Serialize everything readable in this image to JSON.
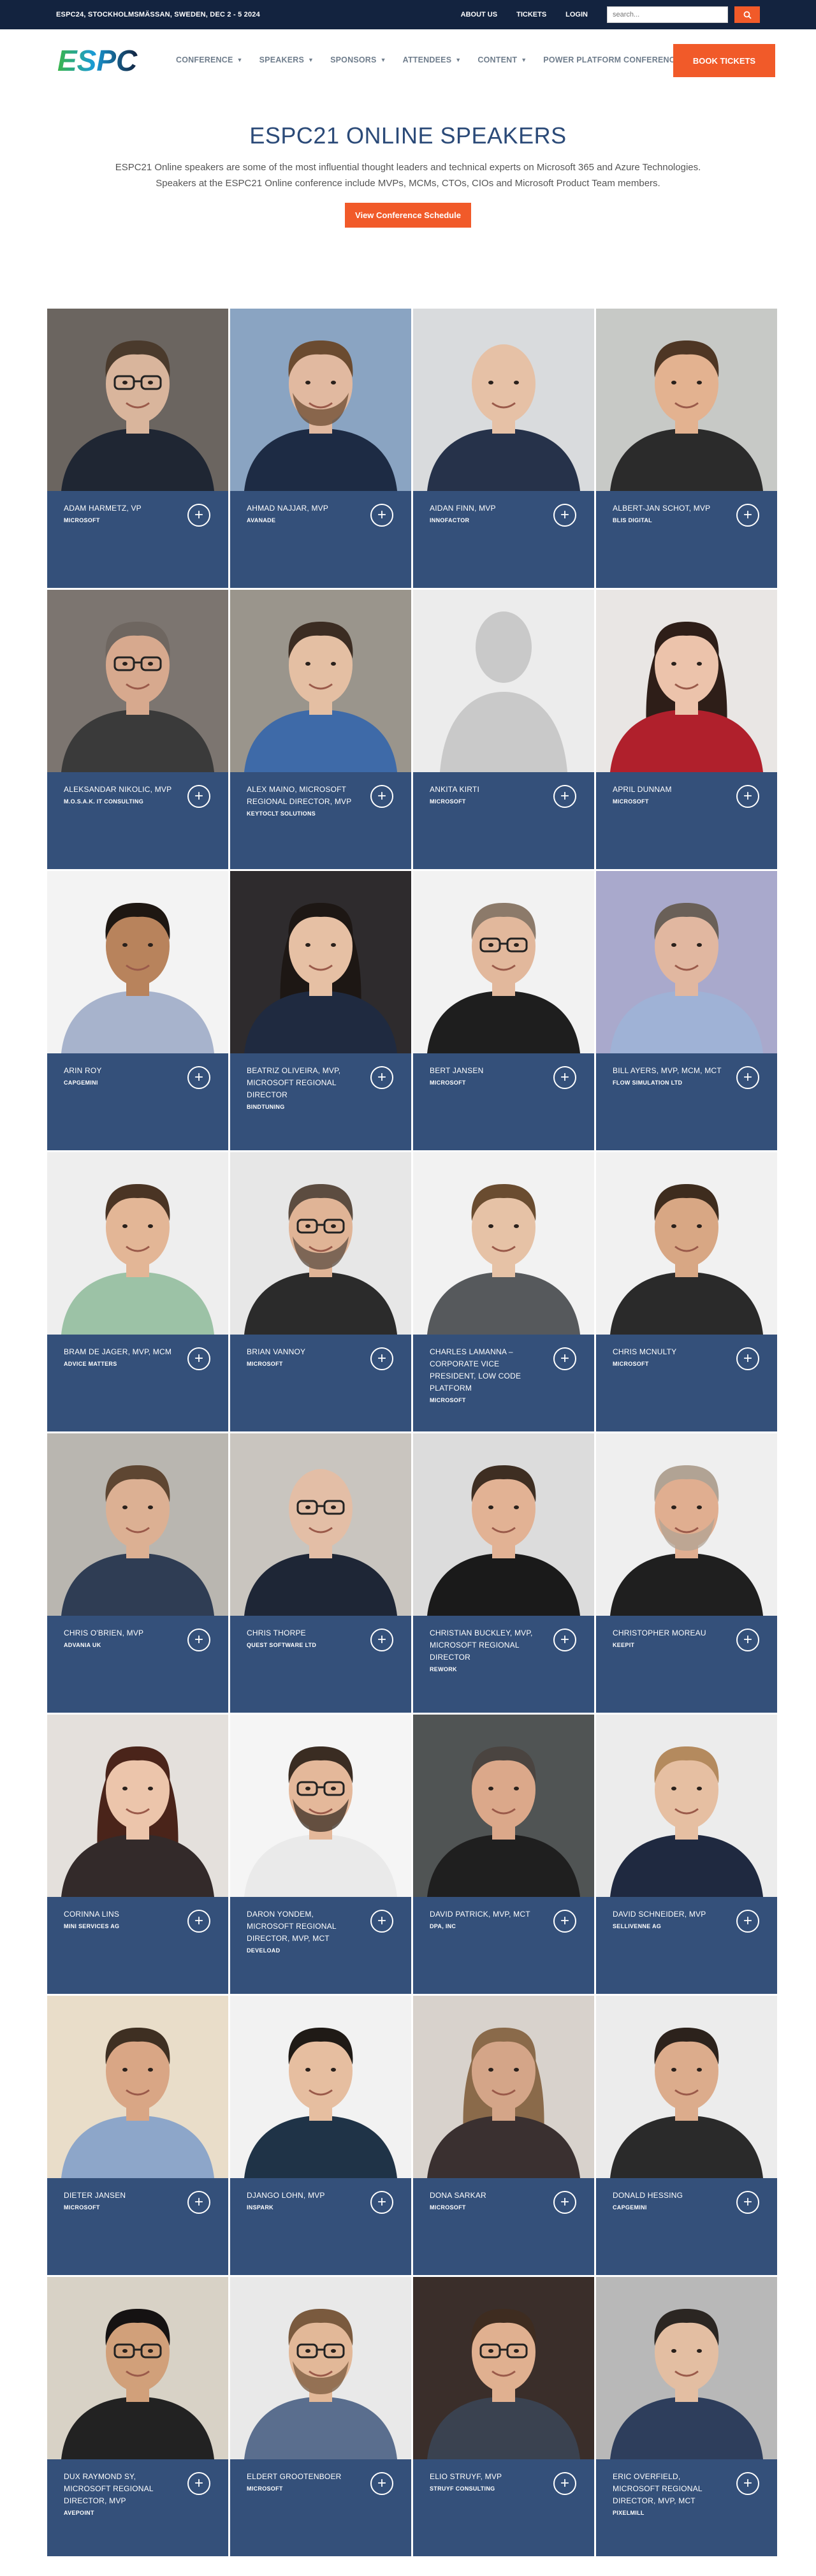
{
  "topbar": {
    "event": "ESPC24, STOCKHOLMSMÄSSAN, SWEDEN, DEC 2 - 5 2024",
    "links": [
      "ABOUT US",
      "TICKETS",
      "LOGIN"
    ],
    "search_placeholder": "search..."
  },
  "nav": {
    "logo_text": "ESPC",
    "items": [
      "CONFERENCE",
      "SPEAKERS",
      "SPONSORS",
      "ATTENDEES",
      "CONTENT",
      "POWER PLATFORM CONFERENCE"
    ],
    "book_label": "BOOK TICKETS"
  },
  "hero": {
    "title": "ESPC21 ONLINE SPEAKERS",
    "description": "ESPC21 Online speakers are some of the most influential thought leaders and technical experts on Microsoft 365 and Azure Technologies. Speakers at the ESPC21 Online conference include MVPs, MCMs, CTOs, CIOs and Microsoft Product Team members.",
    "cta_label": "View Conference Schedule"
  },
  "colors": {
    "topbar": "#13233f",
    "accent": "#f15a29",
    "card": "#34507a",
    "title": "#2b4a78"
  },
  "speakers": [
    {
      "name": "ADAM HARMETZ, VP",
      "company": "MICROSOFT",
      "bg": "#6b6560",
      "skin": "#d9b59c",
      "hair": "#4a3a2c",
      "shirt": "#1f2633",
      "glasses": true
    },
    {
      "name": "AHMAD NAJJAR, MVP",
      "company": "AVANADE",
      "bg": "#8aa4c2",
      "skin": "#e1b9a0",
      "hair": "#6b4b30",
      "shirt": "#1d2b44",
      "beard": true
    },
    {
      "name": "AIDAN FINN, MVP",
      "company": "INNOFACTOR",
      "bg": "#d9dbdd",
      "skin": "#e6c1a6",
      "hair": "#d8b79e",
      "shirt": "#26324a",
      "bald": true
    },
    {
      "name": "ALBERT-JAN SCHOT, MVP",
      "company": "BLIS DIGITAL",
      "bg": "#c7c9c6",
      "skin": "#e3b290",
      "hair": "#4e3624",
      "shirt": "#2b2b2b"
    },
    {
      "name": "ALEKSANDAR NIKOLIC, MVP",
      "company": "M.O.S.A.K. IT CONSULTING",
      "bg": "#7c7570",
      "skin": "#d7a98e",
      "hair": "#6e6660",
      "shirt": "#3a3a3a",
      "glasses": true
    },
    {
      "name": "ALEX MAINO, MICROSOFT REGIONAL DIRECTOR, MVP",
      "company": "KEYTOCLT SOLUTIONS",
      "bg": "#9a958c",
      "skin": "#e4bfa3",
      "hair": "#3b2c22",
      "shirt": "#3e6aa8"
    },
    {
      "name": "ANKITA KIRTI",
      "company": "MICROSOFT",
      "bg": "#ececec",
      "skin": "#c8c8c8",
      "hair": "#c8c8c8",
      "shirt": "#c8c8c8",
      "placeholder": true
    },
    {
      "name": "APRIL DUNNAM",
      "company": "MICROSOFT",
      "bg": "#e9e6e4",
      "skin": "#ecc3ab",
      "hair": "#2e1e18",
      "shirt": "#b0202c",
      "longhair": true
    },
    {
      "name": "ARIN ROY",
      "company": "CAPGEMINI",
      "bg": "#f3f3f3",
      "skin": "#b8835c",
      "hair": "#1e1712",
      "shirt": "#a7b3cc"
    },
    {
      "name": "BEATRIZ OLIVEIRA, MVP, MICROSOFT REGIONAL DIRECTOR",
      "company": "BINDTUNING",
      "bg": "#2e2b2d",
      "skin": "#e6c0a4",
      "hair": "#1d1714",
      "shirt": "#1f2a40",
      "longhair": true
    },
    {
      "name": "BERT JANSEN",
      "company": "MICROSOFT",
      "bg": "#f2f2f2",
      "skin": "#e2b89c",
      "hair": "#8c7a6a",
      "shirt": "#1e1e1e",
      "glasses": true
    },
    {
      "name": "BILL AYERS, MVP, MCM, MCT",
      "company": "FLOW SIMULATION LTD",
      "bg": "#a9a9cc",
      "skin": "#e1b7a0",
      "hair": "#6a6058",
      "shirt": "#9fb2d6"
    },
    {
      "name": "BRAM DE JAGER, MVP, MCM",
      "company": "ADVICE MATTERS",
      "bg": "#eeeeee",
      "skin": "#e3b696",
      "hair": "#4a3424",
      "shirt": "#9cc2a6"
    },
    {
      "name": "BRIAN VANNOY",
      "company": "MICROSOFT",
      "bg": "#e7e7e7",
      "skin": "#e0b496",
      "hair": "#5c4c40",
      "shirt": "#2b2b2b",
      "glasses": true,
      "beard": true
    },
    {
      "name": "CHARLES LAMANNA – CORPORATE VICE PRESIDENT, LOW CODE PLATFORM",
      "company": "MICROSOFT",
      "bg": "#f2f2f2",
      "skin": "#e6c2a6",
      "hair": "#6a4c30",
      "shirt": "#56595c"
    },
    {
      "name": "CHRIS MCNULTY",
      "company": "MICROSOFT",
      "bg": "#f1f1f1",
      "skin": "#d8a784",
      "hair": "#3e2c1e",
      "shirt": "#2a2a2a"
    },
    {
      "name": "CHRIS O'BRIEN, MVP",
      "company": "ADVANIA UK",
      "bg": "#b9b6b0",
      "skin": "#dcb093",
      "hair": "#5e4632",
      "shirt": "#2f3d54"
    },
    {
      "name": "CHRIS THORPE",
      "company": "QUEST SOFTWARE LTD",
      "bg": "#c9c5bf",
      "skin": "#e3bea6",
      "hair": "#9a8a7c",
      "shirt": "#1e2636",
      "bald": true,
      "glasses": true
    },
    {
      "name": "CHRISTIAN BUCKLEY, MVP, MICROSOFT REGIONAL DIRECTOR",
      "company": "REWORK",
      "bg": "#dcdcdc",
      "skin": "#e2b294",
      "hair": "#3e2e22",
      "shirt": "#1a1a1a"
    },
    {
      "name": "CHRISTOPHER MOREAU",
      "company": "KEEPIT",
      "bg": "#efefef",
      "skin": "#e0ae90",
      "hair": "#b1a394",
      "shirt": "#1f1f1f",
      "beard": true
    },
    {
      "name": "CORINNA LINS",
      "company": "MINI SERVICES AG",
      "bg": "#e4e0dc",
      "skin": "#ecc5ab",
      "hair": "#4a241a",
      "shirt": "#332a2a",
      "longhair": true
    },
    {
      "name": "DARON YONDEM, MICROSOFT REGIONAL DIRECTOR, MVP, MCT",
      "company": "DEVELOAD",
      "bg": "#f5f5f5",
      "skin": "#e4b89a",
      "hair": "#3a2c22",
      "shirt": "#eaeaea",
      "glasses": true,
      "beard": true
    },
    {
      "name": "DAVID PATRICK, MVP, MCT",
      "company": "DPA, INC",
      "bg": "#505454",
      "skin": "#dba88a",
      "hair": "#4a4440",
      "shirt": "#1f1f1f"
    },
    {
      "name": "DAVID SCHNEIDER, MVP",
      "company": "SELLIVENNE AG",
      "bg": "#ececec",
      "skin": "#e6bfa2",
      "hair": "#b48a5e",
      "shirt": "#1f2940"
    },
    {
      "name": "DIETER JANSEN",
      "company": "MICROSOFT",
      "bg": "#e9ddc9",
      "skin": "#d9a685",
      "hair": "#3e2f22",
      "shirt": "#8da6c9"
    },
    {
      "name": "DJANGO LOHN, MVP",
      "company": "INSPARK",
      "bg": "#f2f2f2",
      "skin": "#e6bea0",
      "hair": "#1f1a16",
      "shirt": "#1f3347"
    },
    {
      "name": "DONA SARKAR",
      "company": "MICROSOFT",
      "bg": "#d8d2cc",
      "skin": "#d4a588",
      "hair": "#8a6a4a",
      "shirt": "#3a3030",
      "longhair": true
    },
    {
      "name": "DONALD HESSING",
      "company": "CAPGEMINI",
      "bg": "#ececec",
      "skin": "#dcac8c",
      "hair": "#2c221c",
      "shirt": "#2a2a2a"
    },
    {
      "name": "DUX RAYMOND SY, MICROSOFT REGIONAL DIRECTOR, MVP",
      "company": "AVEPOINT",
      "bg": "#d8d2c6",
      "skin": "#d1a07a",
      "hair": "#151212",
      "shirt": "#222222",
      "glasses": true
    },
    {
      "name": "ELDERT GROOTENBOER",
      "company": "MICROSOFT",
      "bg": "#e9e9e9",
      "skin": "#e2b898",
      "hair": "#7a5a3e",
      "shirt": "#5a6e8e",
      "glasses": true,
      "beard": true
    },
    {
      "name": "ELIO STRUYF, MVP",
      "company": "STRUYF CONSULTING",
      "bg": "#3a2e2a",
      "skin": "#e0b090",
      "hair": "#3e2c20",
      "shirt": "#3a4250",
      "glasses": true
    },
    {
      "name": "ERIC OVERFIELD, MICROSOFT REGIONAL DIRECTOR, MVP, MCT",
      "company": "PIXELMILL",
      "bg": "#b8b8b8",
      "skin": "#e3bea2",
      "hair": "#2b2622",
      "shirt": "#2e3e5c"
    }
  ]
}
